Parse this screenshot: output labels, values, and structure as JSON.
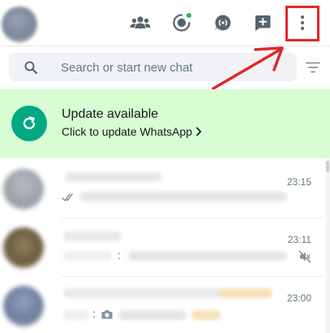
{
  "search": {
    "placeholder": "Search or start new chat",
    "value": ""
  },
  "banner": {
    "title": "Update available",
    "subtitle": "Click to update WhatsApp"
  },
  "chats": [
    {
      "time": "23:15",
      "status_icon": "double-check-icon"
    },
    {
      "time": "23:11",
      "preview_separator": ":",
      "muted_icon": "muted-speaker-icon"
    },
    {
      "time": "23:00",
      "preview_separator": ":",
      "attachment_icon": "camera-icon"
    }
  ],
  "header": {
    "icons": [
      "communities-icon",
      "status-icon",
      "channels-icon",
      "new-chat-icon",
      "menu-icon"
    ]
  },
  "colors": {
    "accent": "#00a884",
    "banner_bg": "#d9fdd3",
    "highlight": "#e0272b",
    "status_dot": "#1fb75b"
  }
}
